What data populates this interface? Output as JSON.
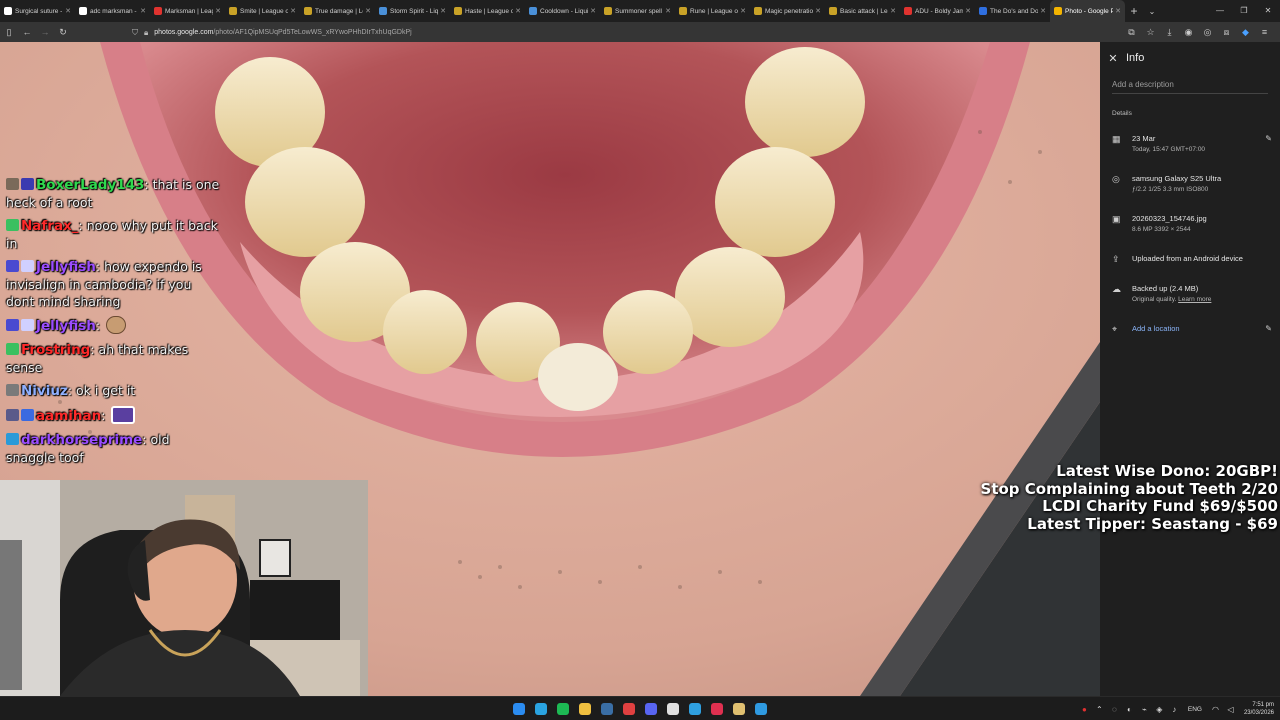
{
  "browser": {
    "tabs": [
      {
        "title": "Surgical suture -",
        "favicon": "wikipedia-icon",
        "color": "#ffffff"
      },
      {
        "title": "adc marksman -",
        "favicon": "google-icon",
        "color": "#ffffff"
      },
      {
        "title": "Marksman | Leag",
        "favicon": "league-wiki-icon",
        "color": "#e0332f"
      },
      {
        "title": "Smite | League of",
        "favicon": "league-wiki-icon",
        "color": "#c9a227"
      },
      {
        "title": "True damage | Le",
        "favicon": "league-wiki-icon",
        "color": "#c9a227"
      },
      {
        "title": "Storm Spirit - Liq",
        "favicon": "liquipedia-icon",
        "color": "#4a90d9"
      },
      {
        "title": "Haste | League of",
        "favicon": "league-wiki-icon",
        "color": "#c9a227"
      },
      {
        "title": "Cooldown - Liqui",
        "favicon": "liquipedia-icon",
        "color": "#4a90d9"
      },
      {
        "title": "Summoner spell",
        "favicon": "league-wiki-icon",
        "color": "#c9a227"
      },
      {
        "title": "Rune | League of",
        "favicon": "league-wiki-icon",
        "color": "#c9a227"
      },
      {
        "title": "Magic penetratio",
        "favicon": "league-wiki-icon",
        "color": "#c9a227"
      },
      {
        "title": "Basic attack | Lea",
        "favicon": "league-wiki-icon",
        "color": "#c9a227"
      },
      {
        "title": "ADU - Boldy Jame",
        "favicon": "youtube-icon",
        "color": "#e0332f"
      },
      {
        "title": "The Do's and Do",
        "favicon": "site-icon",
        "color": "#2f6fe0"
      },
      {
        "title": "Photo - Google P",
        "favicon": "google-photos-icon",
        "color": "#f4b400",
        "active": true
      }
    ],
    "new_tab": "+",
    "url": {
      "domain": "photos.google.com",
      "path": "/photo/AF1QipMSUqPd5TeLowWS_xRYwoPHhDIrTxhUqGDkPj"
    }
  },
  "info_panel": {
    "title": "Info",
    "description_placeholder": "Add a description",
    "details_heading": "Details",
    "date": {
      "primary": "23 Mar",
      "secondary": "Today, 15:47   GMT+07:00"
    },
    "camera": {
      "primary": "samsung Galaxy S25 Ultra",
      "secondary": "ƒ/2.2   1/25   3.3 mm   ISO800"
    },
    "file": {
      "primary": "20260323_154746.jpg",
      "secondary": "8.6 MP   3392 × 2544"
    },
    "upload": {
      "primary": "Uploaded from an Android device"
    },
    "backup": {
      "primary": "Backed up (2.4 MB)",
      "secondary": "Original quality.",
      "link": "Learn more"
    },
    "location": {
      "primary": "Add a location"
    }
  },
  "chat": [
    {
      "user": "BoxerLady143",
      "color": "#2fd94e",
      "text": ": that is one heck of a root",
      "badges": [
        "#7a6a5a",
        "#3a3ab0"
      ]
    },
    {
      "user": "Nafrax_",
      "color": "#ff2a2a",
      "text": ": nooo why put it back in",
      "badges": [
        "#3ac060"
      ]
    },
    {
      "user": "Jellyfish",
      "color": "#9b4dff",
      "text": ": how expendo is invisalign in cambodia? if you dont mind sharing",
      "badges": [
        "#4a4ad0",
        "#d0d0ff"
      ]
    },
    {
      "user": "Jellyfish",
      "color": "#9b4dff",
      "text": ":",
      "badges": [
        "#4a4ad0",
        "#d0d0ff"
      ],
      "emote": "face-emote"
    },
    {
      "user": "Frostring",
      "color": "#ff2a2a",
      "text": ": ah that makes sense",
      "badges": [
        "#3ac060"
      ]
    },
    {
      "user": "Niviuz",
      "color": "#8fb0ff",
      "text": ": ok i get it",
      "badges": [
        "#7a7a7a"
      ]
    },
    {
      "user": "aamihan",
      "color": "#ff2a2a",
      "text": ":",
      "badges": [
        "#5a5a8a",
        "#3a6ae0"
      ],
      "emote": "camera-emote"
    },
    {
      "user": "darkhorseprime",
      "color": "#9b4dff",
      "text": ": old snaggle toof",
      "badges": [
        "#2a9ad8"
      ]
    }
  ],
  "overlay_labels": [
    "Latest Wise Dono: 20GBP!",
    "Stop Complaining about Teeth 2/20",
    "LCDI Charity Fund $69/$500",
    "Latest Tipper: Seastang  - $69"
  ],
  "taskbar": {
    "apps": [
      {
        "name": "windows-start-icon",
        "color": "#2b8cf0"
      },
      {
        "name": "telegram-icon",
        "color": "#2aa3e0"
      },
      {
        "name": "spotify-icon",
        "color": "#1db954"
      },
      {
        "name": "file-explorer-icon",
        "color": "#f0c040"
      },
      {
        "name": "steam-icon",
        "color": "#3a6ea5"
      },
      {
        "name": "app-red-icon",
        "color": "#e04040"
      },
      {
        "name": "discord-icon",
        "color": "#5865f2"
      },
      {
        "name": "chrome-icon",
        "color": "#e0e0e0"
      },
      {
        "name": "edge-icon",
        "color": "#2fa0e0"
      },
      {
        "name": "app-red2-icon",
        "color": "#e03050"
      },
      {
        "name": "pen-icon",
        "color": "#e0c070"
      },
      {
        "name": "snipping-icon",
        "color": "#2f9ae0"
      }
    ],
    "language": "ENG",
    "time": "7:51 pm",
    "date": "23/03/2026"
  }
}
